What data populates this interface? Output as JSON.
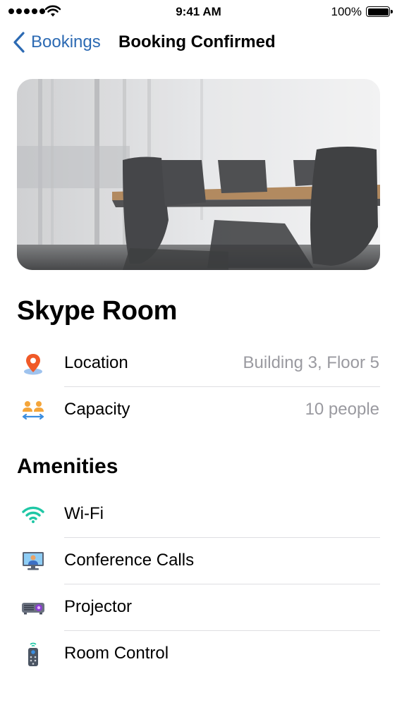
{
  "status_bar": {
    "time": "9:41 AM",
    "battery": "100%"
  },
  "nav": {
    "back_label": "Bookings",
    "title": "Booking Confirmed"
  },
  "room": {
    "name": "Skype Room",
    "details": [
      {
        "label": "Location",
        "value": "Building 3, Floor 5",
        "icon": "location-pin-icon"
      },
      {
        "label": "Capacity",
        "value": "10 people",
        "icon": "people-icon"
      }
    ]
  },
  "amenities": {
    "title": "Amenities",
    "items": [
      {
        "label": "Wi-Fi",
        "icon": "wifi-icon"
      },
      {
        "label": "Conference Calls",
        "icon": "video-call-icon"
      },
      {
        "label": "Projector",
        "icon": "projector-icon"
      },
      {
        "label": "Room Control",
        "icon": "remote-control-icon"
      }
    ]
  },
  "colors": {
    "accent": "#2c6ab3",
    "secondary_text": "#9a9aa0",
    "divider": "#dedee2"
  }
}
